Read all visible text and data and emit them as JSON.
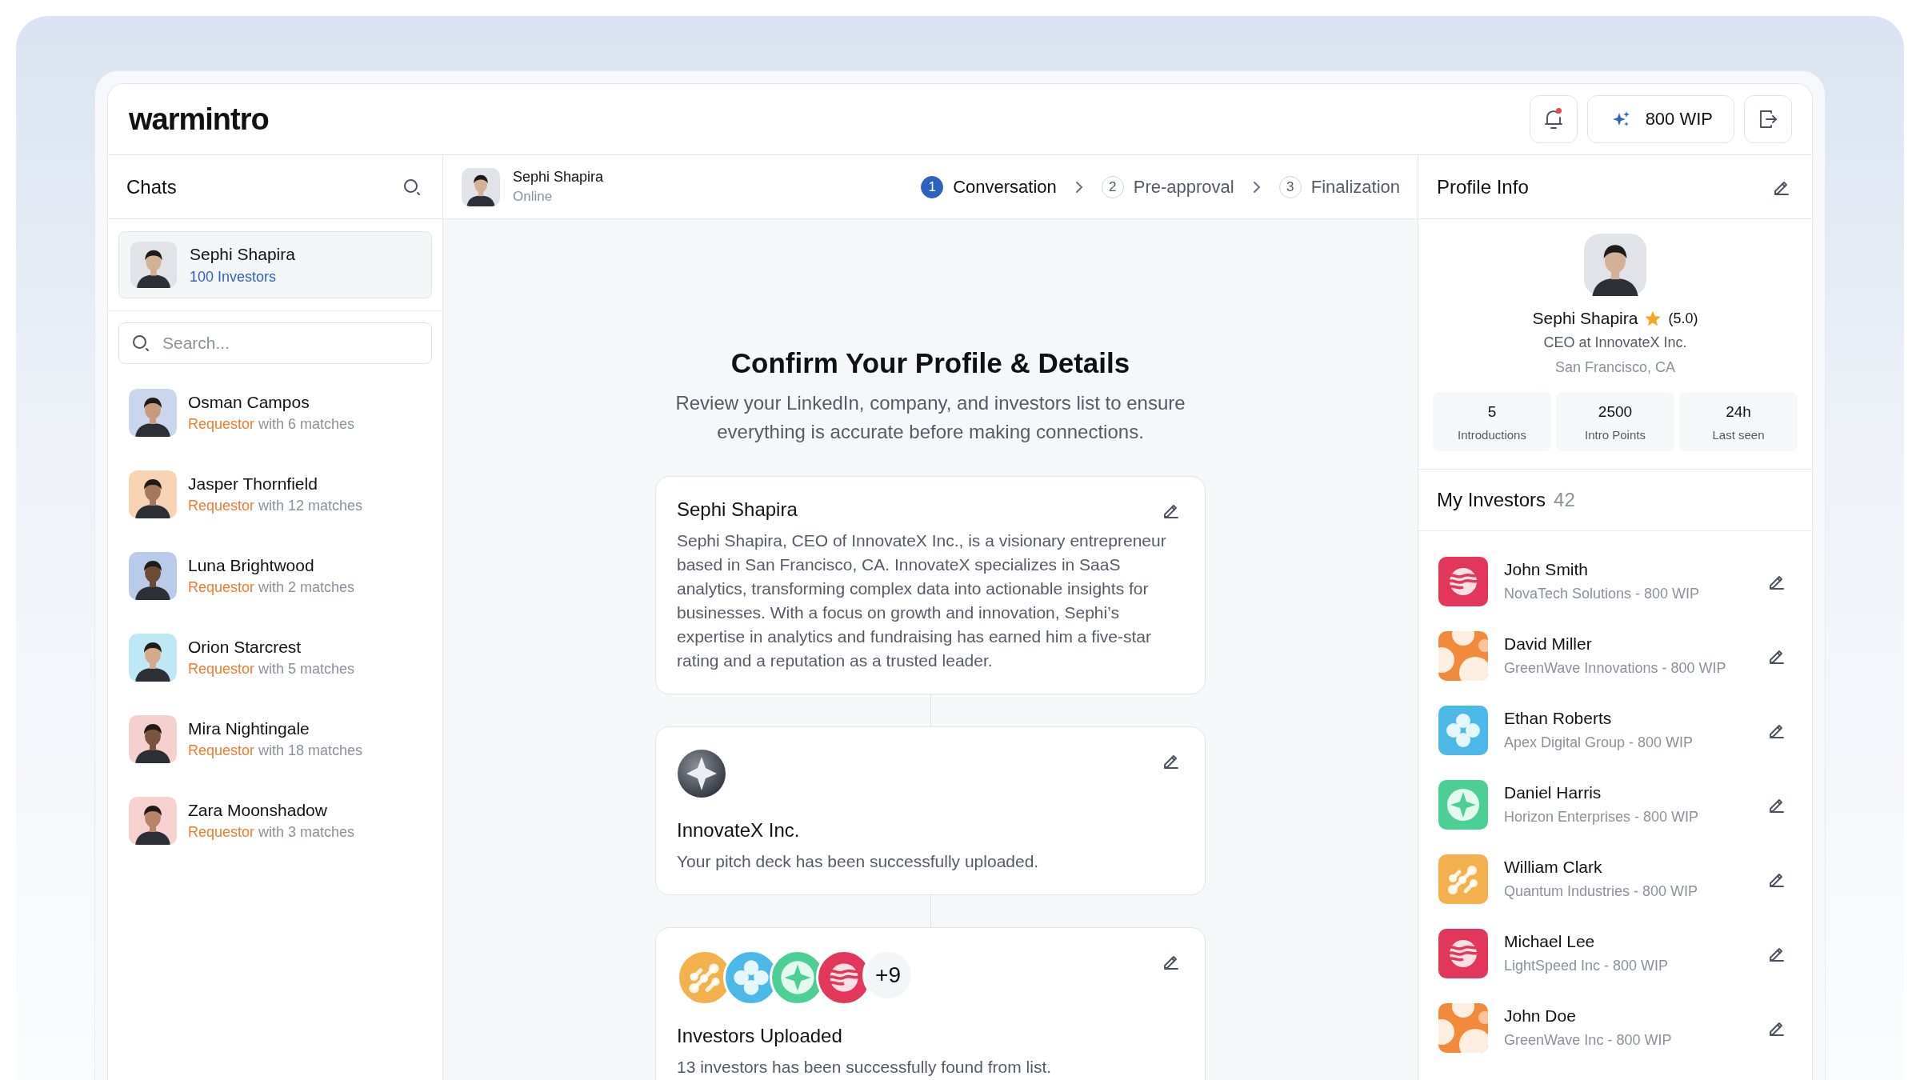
{
  "header": {
    "logo": "warmintro",
    "notifications": {
      "unread": true
    },
    "wip_button": "800 WIP"
  },
  "chats": {
    "title": "Chats",
    "current": {
      "name": "Sephi Shapira",
      "subtitle": "100 Investors"
    },
    "search": {
      "placeholder": "Search..."
    },
    "items": [
      {
        "name": "Osman Campos",
        "role": "Requestor",
        "detail": "with 6 matches"
      },
      {
        "name": "Jasper Thornfield",
        "role": "Requestor",
        "detail": "with 12 matches"
      },
      {
        "name": "Luna Brightwood",
        "role": "Requestor",
        "detail": "with 2 matches"
      },
      {
        "name": "Orion Starcrest",
        "role": "Requestor",
        "detail": "with 5 matches"
      },
      {
        "name": "Mira Nightingale",
        "role": "Requestor",
        "detail": "with 18 matches"
      },
      {
        "name": "Zara Moonshadow",
        "role": "Requestor",
        "detail": "with 3 matches"
      }
    ]
  },
  "conversation": {
    "contact": {
      "name": "Sephi Shapira",
      "status": "Online"
    },
    "steps": [
      {
        "number": "1",
        "label": "Conversation",
        "selected": true
      },
      {
        "number": "2",
        "label": "Pre-approval",
        "selected": false
      },
      {
        "number": "3",
        "label": "Finalization",
        "selected": false
      }
    ],
    "title": "Confirm Your Profile & Details",
    "subtitle": "Review your LinkedIn, company, and investors list to ensure everything is accurate before making connections.",
    "cards": [
      {
        "kind": "text",
        "title": "Sephi Shapira",
        "body": "Sephi Shapira, CEO of InnovateX Inc., is a visionary entrepreneur based in San Francisco, CA. InnovateX specializes in SaaS analytics, transforming complex data into actionable insights for businesses. With a focus on growth and innovation, Sephi’s expertise in analytics and fundraising has earned him a five-star rating and a reputation as a trusted leader."
      },
      {
        "kind": "company",
        "title": "InnovateX Inc.",
        "body": "Your pitch deck has been successfully uploaded."
      },
      {
        "kind": "investors",
        "logos": [
          {
            "kind": "molecule",
            "color": "#f2b14d"
          },
          {
            "kind": "clover",
            "color": "#4bb8e8"
          },
          {
            "kind": "compass",
            "color": "#4ccf94"
          },
          {
            "kind": "waves",
            "color": "#e2365a"
          }
        ],
        "more": "+9",
        "title": "Investors Uploaded",
        "body": "13 investors has been successfully found from list."
      }
    ]
  },
  "profile": {
    "title": "Profile Info",
    "name": "Sephi Shapira",
    "rating": "(5.0)",
    "role": "CEO at InnovateX Inc.",
    "location": "San Francisco, CA",
    "stats": [
      {
        "value": "5",
        "label": "Introductions"
      },
      {
        "value": "2500",
        "label": "Intro Points"
      },
      {
        "value": "24h",
        "label": "Last seen"
      }
    ]
  },
  "investors": {
    "title": "My Investors",
    "count": "42",
    "items": [
      {
        "name": "John Smith",
        "detail": "NovaTech Solutions - 800 WIP",
        "kind": "waves",
        "color": "#e2365a"
      },
      {
        "name": "David Miller",
        "detail": "GreenWave Innovations - 800 WIP",
        "kind": "blobs",
        "color": "#f28a3c"
      },
      {
        "name": "Ethan Roberts",
        "detail": "Apex Digital Group - 800 WIP",
        "kind": "clover",
        "color": "#4bb8e8"
      },
      {
        "name": "Daniel Harris",
        "detail": "Horizon Enterprises - 800 WIP",
        "kind": "compass",
        "color": "#4ccf94"
      },
      {
        "name": "William Clark",
        "detail": "Quantum Industries - 800 WIP",
        "kind": "molecule",
        "color": "#f2b14d"
      },
      {
        "name": "Michael Lee",
        "detail": "LightSpeed Inc - 800 WIP",
        "kind": "waves",
        "color": "#e2365a"
      },
      {
        "name": "John Doe",
        "detail": "GreenWave Inc - 800 WIP",
        "kind": "blobs",
        "color": "#f28a3c"
      }
    ]
  }
}
